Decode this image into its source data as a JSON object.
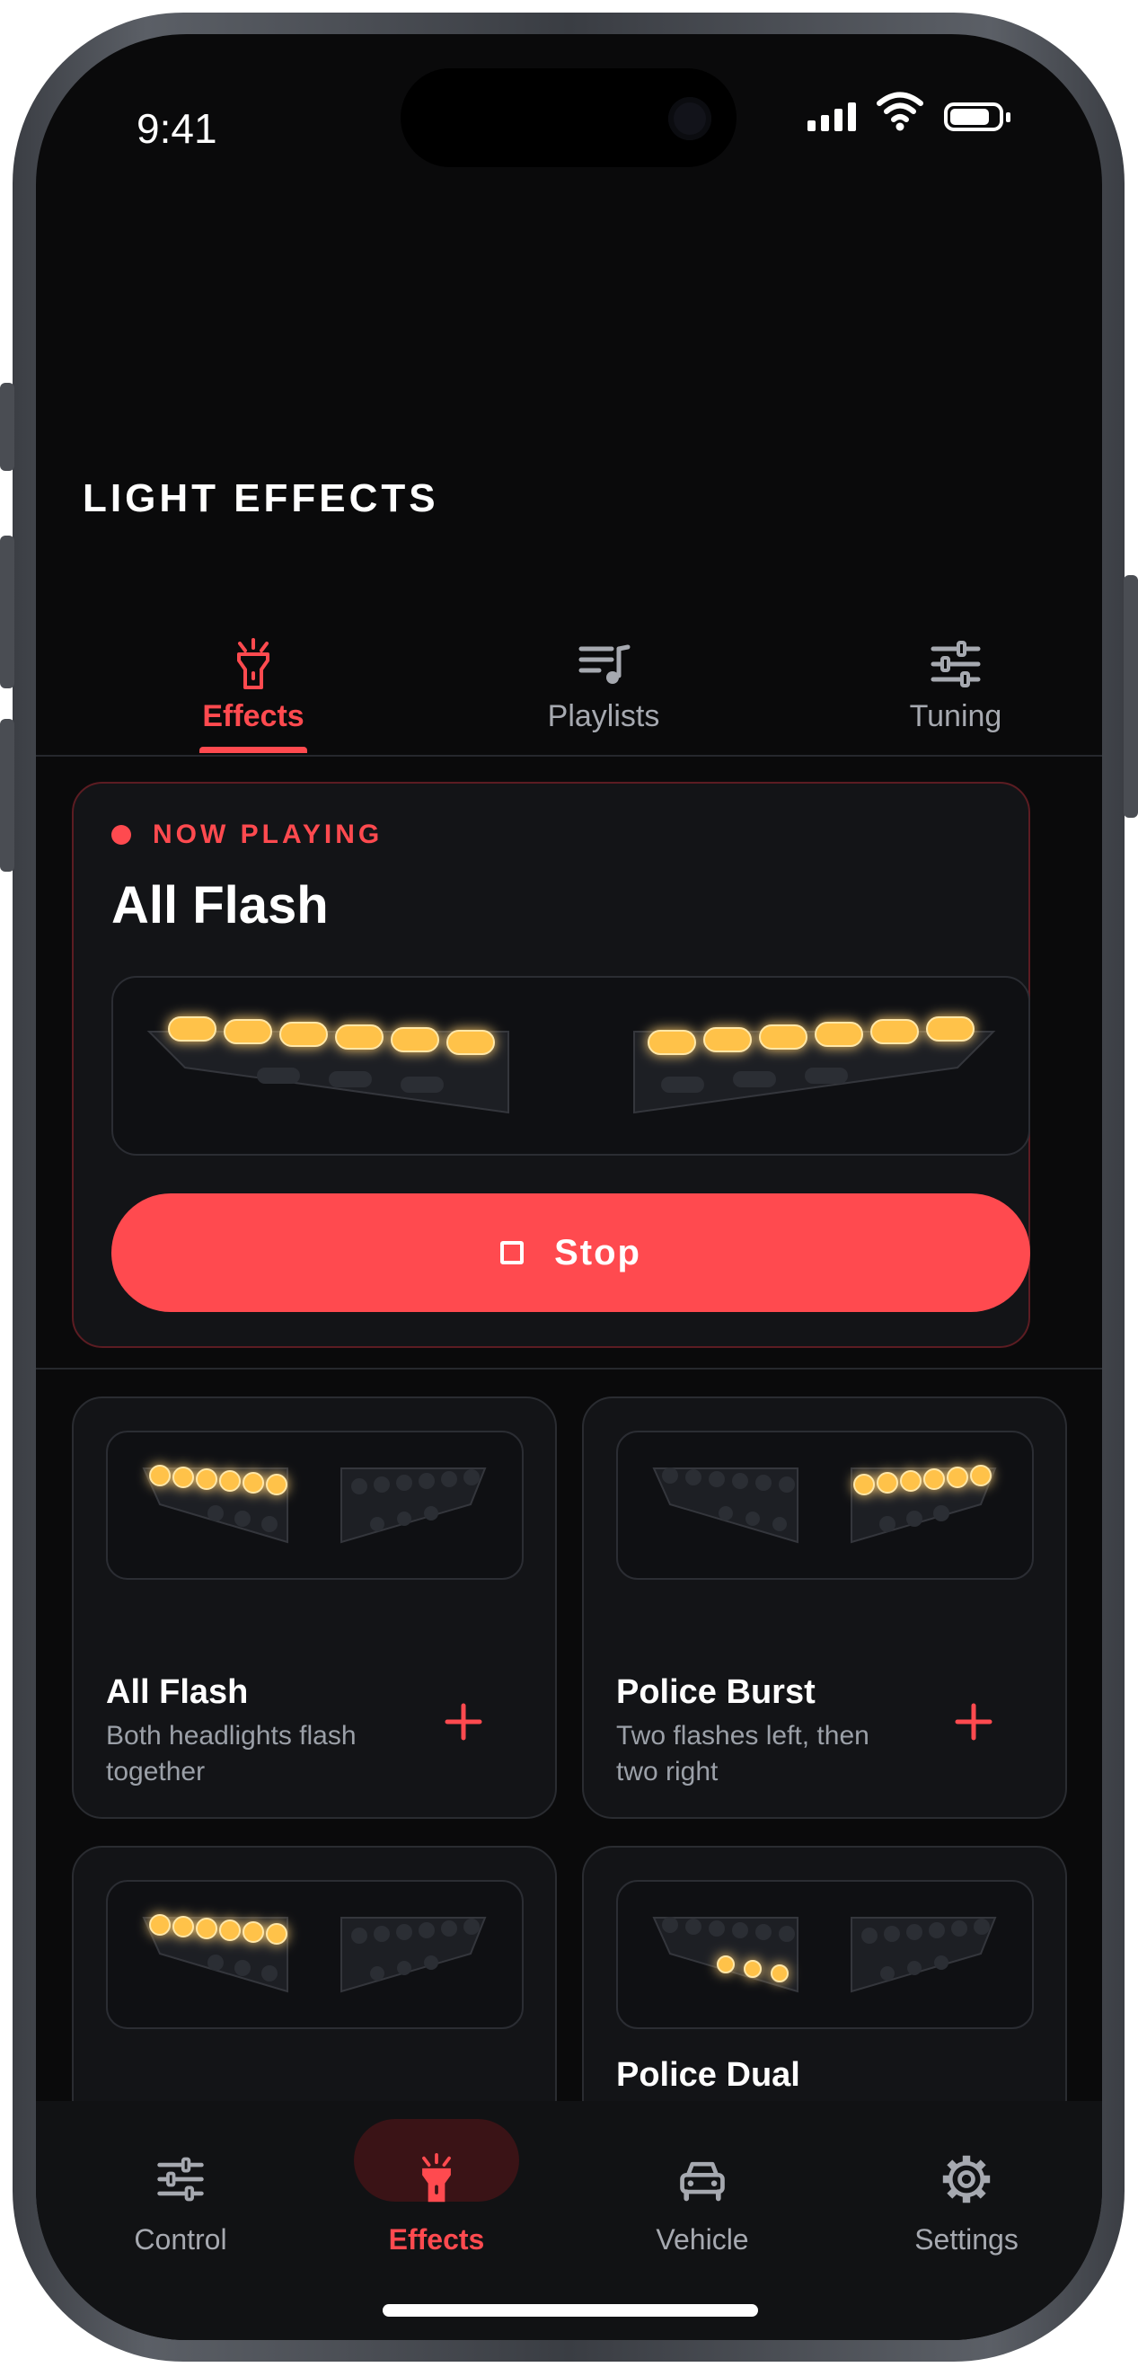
{
  "status_bar": {
    "time": "9:41"
  },
  "page": {
    "title": "LIGHT EFFECTS"
  },
  "tabs": [
    {
      "label": "Effects",
      "icon": "flashlight-icon",
      "active": true
    },
    {
      "label": "Playlists",
      "icon": "playlist-icon",
      "active": false
    },
    {
      "label": "Tuning",
      "icon": "sliders-icon",
      "active": false
    }
  ],
  "now_playing": {
    "label": "NOW PLAYING",
    "title": "All Flash",
    "stop_label": "Stop"
  },
  "effects": [
    {
      "title": "All Flash",
      "description": "Both headlights flash together"
    },
    {
      "title": "Police Burst",
      "description": "Two flashes left, then two right"
    },
    {
      "title": "",
      "description": ""
    },
    {
      "title": "Police Dual",
      "description": ""
    }
  ],
  "bottom_nav": [
    {
      "label": "Control",
      "icon": "sliders-icon",
      "active": false
    },
    {
      "label": "Effects",
      "icon": "flashlight-icon",
      "active": true
    },
    {
      "label": "Vehicle",
      "icon": "car-icon",
      "active": false
    },
    {
      "label": "Settings",
      "icon": "gear-icon",
      "active": false
    }
  ],
  "colors": {
    "accent": "#ff4a4f",
    "background": "#0a0a0b",
    "card": "#131417",
    "led_on": "#ffc24a",
    "muted_text": "#a6a9b0"
  }
}
